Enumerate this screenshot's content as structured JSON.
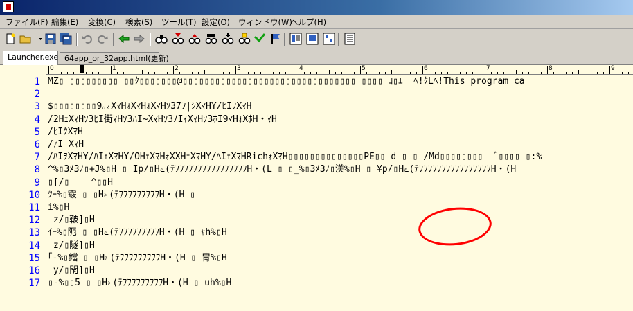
{
  "window": {
    "icon": "app-icon"
  },
  "menu": [
    "ファイル(F)",
    "編集(E)",
    "変換(C)",
    "検索(S)",
    "ツール(T)",
    "設定(O)",
    "ウィンドウ(W)",
    "ヘルプ(H)"
  ],
  "toolbar": {
    "icons": [
      "new-file-icon",
      "open-icon",
      "save-icon",
      "save-all-icon",
      "undo-icon",
      "redo-icon",
      "back-icon",
      "forward-icon",
      "find-icon",
      "find-next-icon",
      "find-prev-icon",
      "bookmark-icon",
      "bookmark-next-icon",
      "bookmark-prev-icon",
      "tag-icon",
      "grep-icon",
      "compare-icon",
      "macro-icon",
      "settings-icon"
    ]
  },
  "tabs": [
    {
      "label": "Launcher.exe",
      "active": true
    },
    {
      "label": "64app_or_32app.html(更新)",
      "active": false
    }
  ],
  "ruler": {
    "labels": [
      "0",
      "1",
      "2",
      "3",
      "4",
      "5",
      "6",
      "7",
      "8",
      "9"
    ]
  },
  "lines": [
    {
      "n": "1",
      "text": "MZ▯ ▯▯▯▯▯▯▯▯▯ ▯▯ｸ▯▯▯▯▯▯▯@▯▯▯▯▯▯▯▯▯▯▯▯▯▯▯▯▯▯▯▯▯▯▯▯▯▯▯▯▯▯▯▯ ▯▯▯▯ ｺ▯ｴ  ﾍ!ｸLﾍ!This program ca"
    },
    {
      "n": "2",
      "text": ""
    },
    {
      "n": "3",
      "text": "$▯▯▯▯▯▯▯▯9｡ｫXﾏHｫXﾏHｫXﾏHｿ37ﾌ|ｼXﾏHY/ﾋIｦXﾏH"
    },
    {
      "n": "4",
      "text": "/2HｪXﾏHｿ3ﾋI街ﾏHｿ3ﾊI~XﾏHｿ3ﾉIｨXﾏHｿ3ﾎI9ﾏHｫXﾎH・ﾏH"
    },
    {
      "n": "5",
      "text": "/ﾋIｸXﾏH"
    },
    {
      "n": "6",
      "text": "/ｱI XﾏH"
    },
    {
      "n": "7",
      "text": "/ﾊIｦXﾏHY/ﾊIｪXﾏHY/OHｪXﾏHｫXXHｪXﾏHY/ﾍIｪXﾏHRichｫXﾏH▯▯▯▯▯▯▯▯▯▯▯▯▯▯PE▯▯ d ▯ ▯ /Md▯▯▯▯▯▯▯▯  ﾞ▯▯▯▯ ▯:%"
    },
    {
      "n": "8",
      "text": "^%▯3ﾒ3ﾉ▯+J%▯H ▯ Ip/▯H೬(ﾃﾌﾌﾌﾌﾌﾌﾌﾌﾌﾌﾌﾌﾌﾌﾌﾌH・(L ▯ ▯_%▯3ﾒ3ﾉ▯渼%▯H ▯ ¥p/▯H೬(ﾃﾌﾌﾌﾌﾌﾌﾌﾌﾌﾌﾌﾌﾌﾌﾌﾌH・(H"
    },
    {
      "n": "9",
      "text": "▯[/▯    ^▯▯H"
    },
    {
      "n": "10",
      "text": "ﾂｰ%▯霰 ▯ ▯H೬(ﾃﾌﾌﾌﾌﾌﾌﾌﾌﾌH・(H ▯"
    },
    {
      "n": "11",
      "text": "i%▯H"
    },
    {
      "n": "12",
      "text": " z/▯鞁]▯H"
    },
    {
      "n": "13",
      "text": "ｲｰ%▯阨 ▯ ▯H೬(ﾃﾌﾌﾌﾌﾌﾌﾌﾌﾌH・(H ▯ ｬh%▯H"
    },
    {
      "n": "14",
      "text": " z/▯隧]▯H"
    },
    {
      "n": "15",
      "text": "｢-%▯鐺 ▯ ▯H೬(ﾃﾌﾌﾌﾌﾌﾌﾌﾌﾌH・(H ▯ 冑%▯H"
    },
    {
      "n": "16",
      "text": " y/▯閇]▯H"
    },
    {
      "n": "17",
      "text": "▯-%▯▯5 ▯ ▯H೬(ﾃﾌﾌﾌﾌﾌﾌﾌﾌﾌH・(H ▯ uh%▯H"
    }
  ],
  "colors": {
    "editor_bg": "#fffbe0",
    "line_number": "#0000ff",
    "annotation": "#ff0000"
  }
}
